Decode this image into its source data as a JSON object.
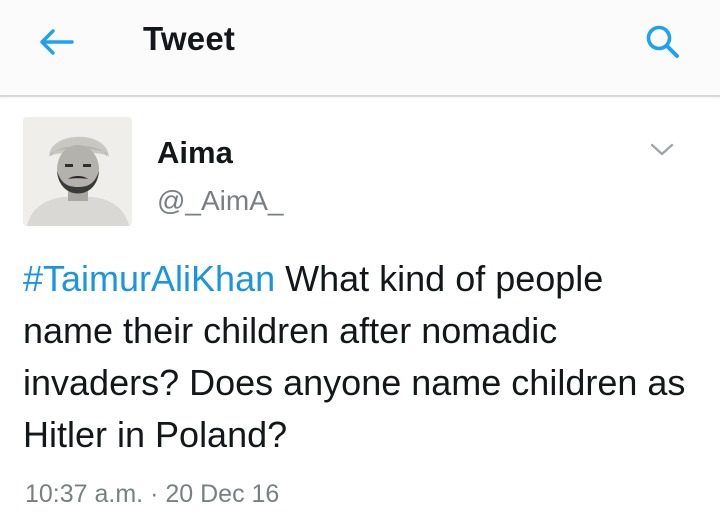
{
  "header": {
    "title": "Tweet",
    "back_icon": "arrow-left-icon",
    "search_icon": "search-icon",
    "accent_color": "#1da1f2"
  },
  "tweet": {
    "author": {
      "name": "Aima",
      "handle": "@_AimA_"
    },
    "hashtag": "#TaimurAliKhan",
    "text": " What kind of people name their children after nomadic invaders? Does anyone name children as Hitler in Poland?",
    "time": "10:37 a.m.",
    "separator": " · ",
    "date": "20 Dec 16",
    "more_icon": "chevron-down-icon",
    "hashtag_color": "#1b95e0"
  }
}
